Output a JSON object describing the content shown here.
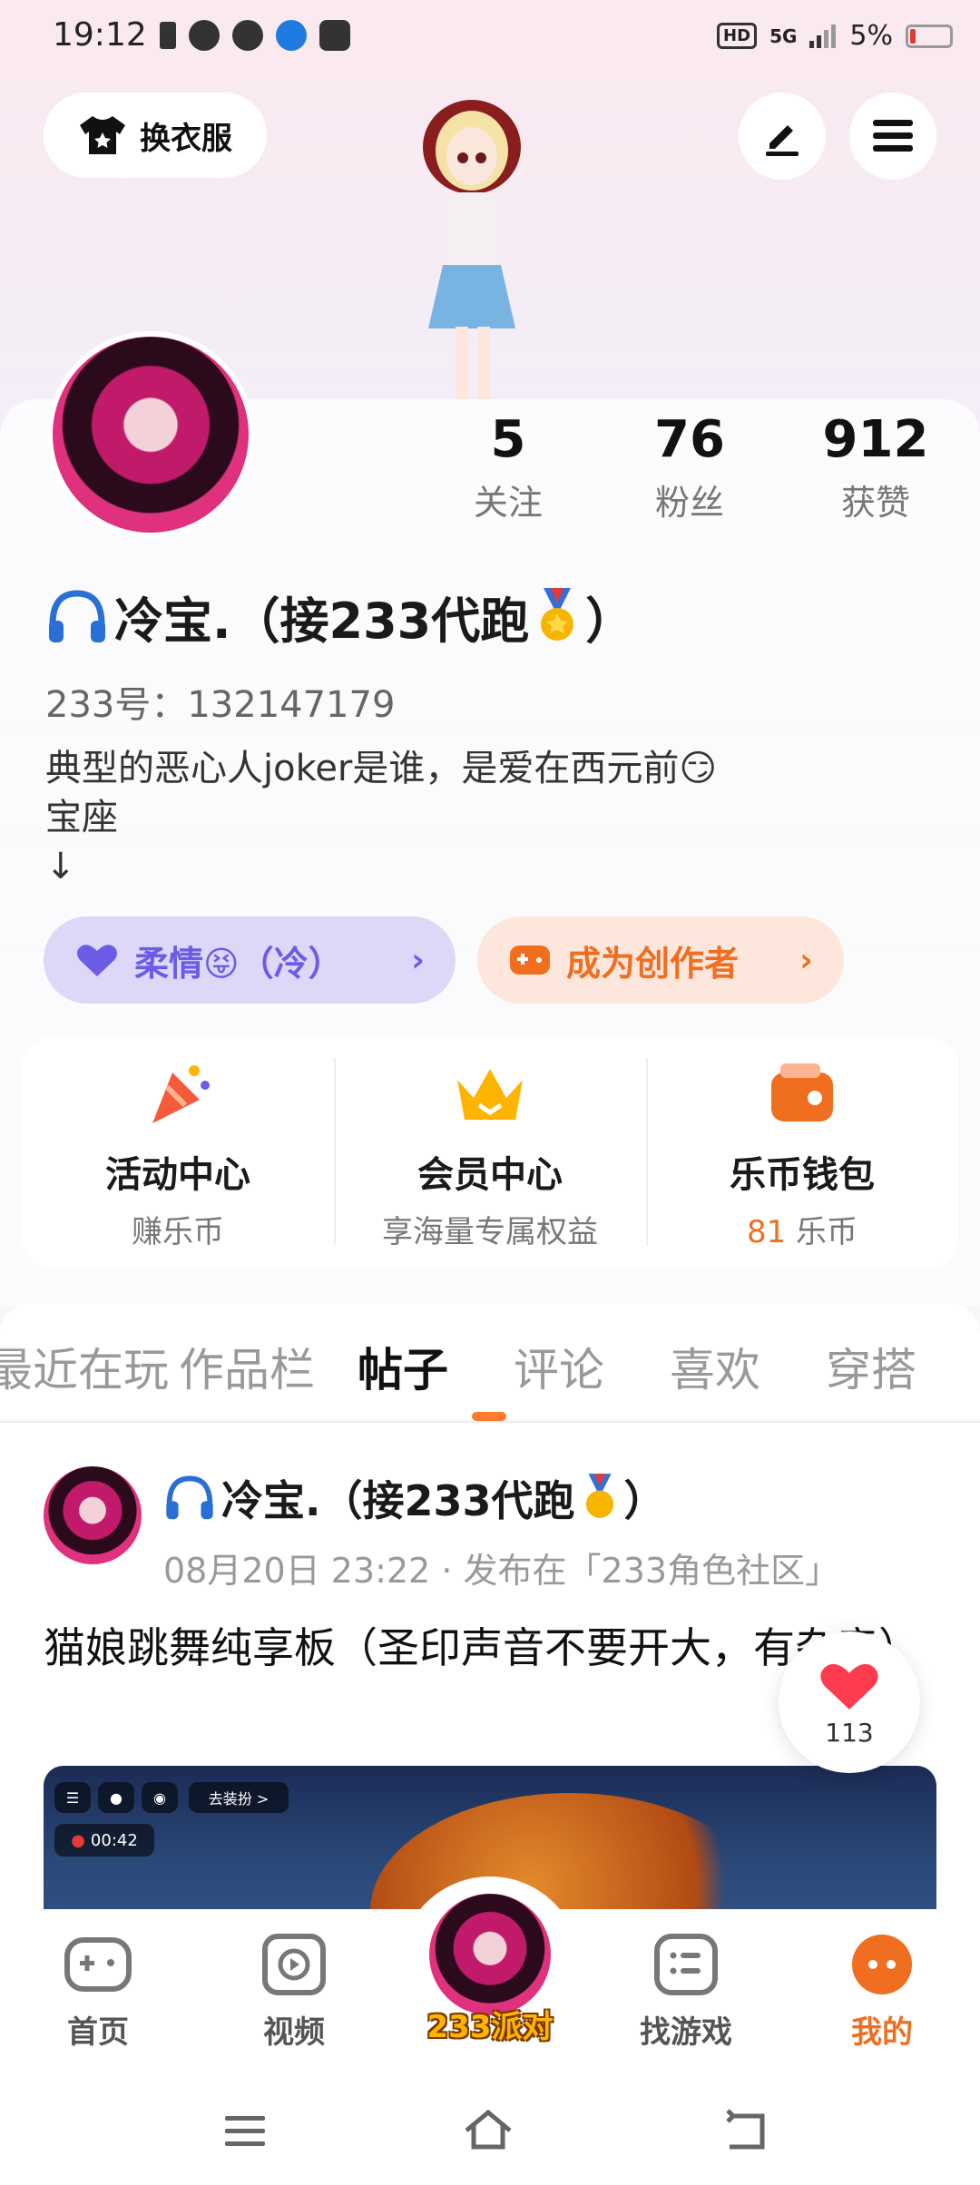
{
  "status_bar": {
    "time": "19:12",
    "network": "5G",
    "hd_badge": "HD",
    "battery": "5%"
  },
  "top": {
    "outfit_button": "换衣服"
  },
  "profile": {
    "stats": [
      {
        "value": "5",
        "label": "关注"
      },
      {
        "value": "76",
        "label": "粉丝"
      },
      {
        "value": "912",
        "label": "获赞"
      }
    ],
    "nickname": "冷宝.（接233代跑",
    "nickname_end": "）",
    "uid": "233号：132147179",
    "bio_line1": "典型的恶心人joker是谁，是爱在西元前😏",
    "bio_line2": "宝座",
    "bio_line3": "↓",
    "tag_pill": "柔情😝（冷）",
    "creator_pill": "成为创作者"
  },
  "quick_entries": [
    {
      "title": "活动中心",
      "subtitle": "赚乐币",
      "color": "#f45b3c"
    },
    {
      "title": "会员中心",
      "subtitle": "享海量专属权益",
      "color": "#ffb400"
    },
    {
      "title": "乐币钱包",
      "subtitle_value": "81",
      "subtitle": "乐币",
      "color": "#f06e20"
    }
  ],
  "tabs": [
    "最近在玩",
    "作品栏",
    "帖子",
    "评论",
    "喜欢",
    "穿搭"
  ],
  "active_tab": "帖子",
  "post": {
    "author": "冷宝.（接233代跑",
    "author_end": "）",
    "meta": "08月20日 23:22 · 发布在「233角色社区」",
    "title": "猫娘跳舞纯享板（圣印声音不要开大，有杂音）",
    "likes": "113",
    "media_chip_dress": "去装扮 >",
    "media_time": "00:42"
  },
  "bottom_nav": [
    {
      "label": "首页",
      "icon": "gamepad-icon"
    },
    {
      "label": "视频",
      "icon": "play-icon"
    },
    {
      "label": "233派对",
      "icon": "party-avatar"
    },
    {
      "label": "找游戏",
      "icon": "list-icon"
    },
    {
      "label": "我的",
      "icon": "me-icon"
    }
  ],
  "colors": {
    "accent": "#f06e20",
    "purple": "#6b5ce7",
    "like": "#ff3b4f"
  }
}
